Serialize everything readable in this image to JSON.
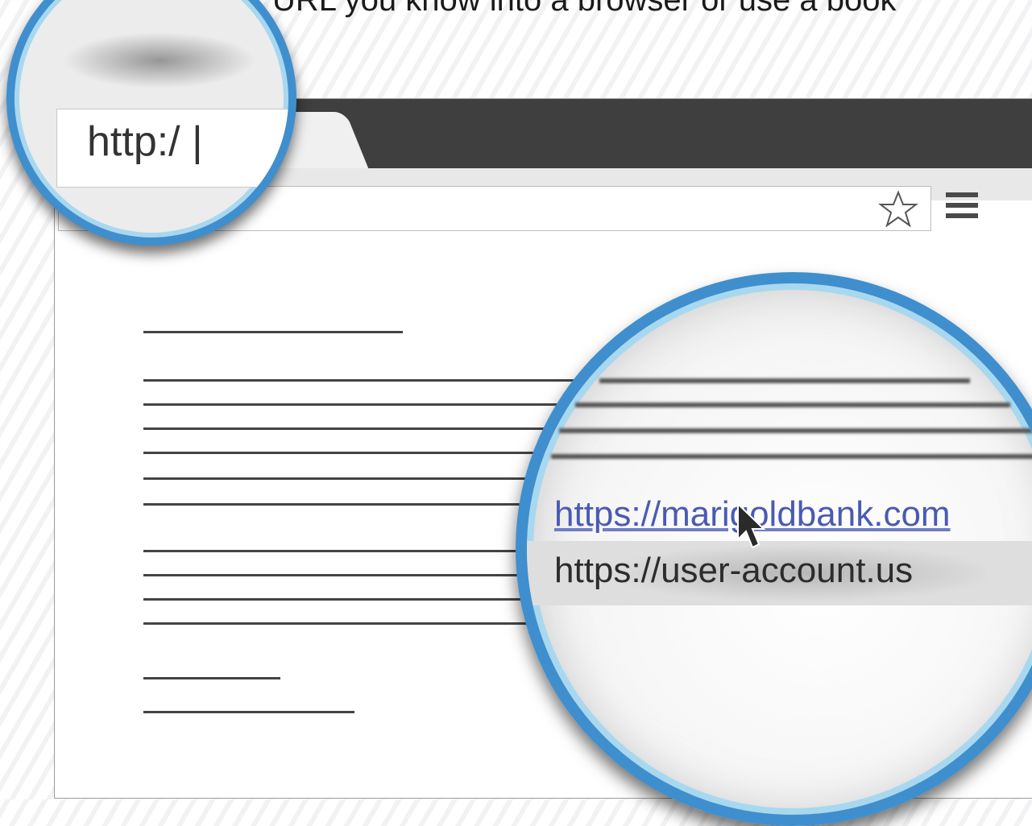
{
  "caption": {
    "text": "URL you know into a browser or use a book"
  },
  "browser": {
    "address_bar": {
      "value": ""
    },
    "icons": {
      "bookmark": "star-icon",
      "menu": "hamburger-menu-icon"
    }
  },
  "small_magnifier": {
    "url_text": "http:/ |"
  },
  "large_magnifier": {
    "link_text": "https://marigoldbank.com",
    "suggestion_text": "https://user-account.us",
    "cursor": "arrow-cursor-icon"
  },
  "colors": {
    "accent": "#3a8fd1",
    "lens_rim": "#3f8fce",
    "titlebar": "#3f3f3f",
    "link": "#4a5ab3"
  }
}
